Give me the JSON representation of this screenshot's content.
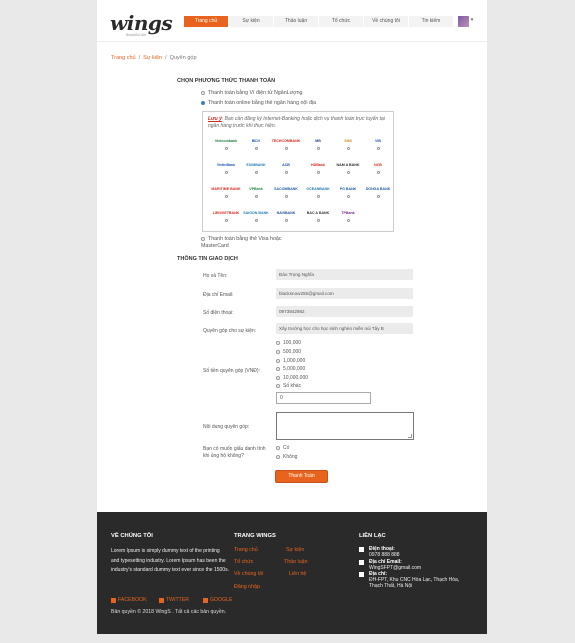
{
  "header": {
    "logo_text": "wings",
    "logo_subtext": "Beautiful Life",
    "nav": [
      "Trang chủ",
      "Sự kiện",
      "Thảo luận",
      "Tổ chức",
      "Về chúng tôi",
      "Tin kiếm"
    ],
    "active_nav_index": 0,
    "accent_color": "#e8641e"
  },
  "breadcrumb": {
    "items": [
      "Trang chủ",
      "Sự kiện",
      "Quyên góp"
    ],
    "separator": "/"
  },
  "payment": {
    "section_title": "CHỌN PHƯƠNG THỨC THANH TOÁN",
    "options": [
      "Thanh toán bằng Ví điện tử NgânLượng",
      "Thanh toán online bằng thẻ ngân hàng nội địa",
      "Thanh toán bằng thẻ Visa hoặc MasterCard"
    ],
    "selected_index": 1,
    "note_label": "Lưu ý",
    "note_text": ": Bạn cần đăng ký Internet-Banking hoặc dịch vụ thanh toán trực tuyến tại ngân hàng trước khi thực hiện.",
    "banks": [
      {
        "name": "Vietcombank",
        "color": "#1e7a3c"
      },
      {
        "name": "BIDV",
        "color": "#1d5aa8"
      },
      {
        "name": "TECHCOMBANK",
        "color": "#d9261c"
      },
      {
        "name": "MB",
        "color": "#1d3f8a"
      },
      {
        "name": "SHB",
        "color": "#d4881b"
      },
      {
        "name": "VIB",
        "color": "#1e5aa8"
      },
      {
        "name": "VietinBank",
        "color": "#1e5aa8"
      },
      {
        "name": "EXIMBANK",
        "color": "#1e7ab5"
      },
      {
        "name": "ACB",
        "color": "#1e4ea0"
      },
      {
        "name": "HDBank",
        "color": "#d9261c"
      },
      {
        "name": "NAM A BANK",
        "color": "#2b2b2b"
      },
      {
        "name": "NCB",
        "color": "#d9261c"
      },
      {
        "name": "MARITIME BANK",
        "color": "#d9261c"
      },
      {
        "name": "VPBank",
        "color": "#1e8a3c"
      },
      {
        "name": "SACOMBANK",
        "color": "#1e5aa8"
      },
      {
        "name": "OCEANBANK",
        "color": "#1e7ab5"
      },
      {
        "name": "PG BANK",
        "color": "#1e5aa8"
      },
      {
        "name": "DONGA BANK",
        "color": "#1e5aa8"
      },
      {
        "name": "LIENVIETBANK",
        "color": "#d9261c"
      },
      {
        "name": "SAIGON BANK",
        "color": "#1e7ab5"
      },
      {
        "name": "NAVIBANK",
        "color": "#1e4ea0"
      },
      {
        "name": "BAC A BANK",
        "color": "#333333"
      },
      {
        "name": "TPBank",
        "color": "#7a2a8a"
      }
    ]
  },
  "transaction": {
    "section_title": "THÔNG TIN GIAO DỊCH",
    "fields": [
      {
        "label": "Họ và Tên:",
        "value": "Đào Trọng Nghĩa"
      },
      {
        "label": "Địa chỉ Email:",
        "value": "blacksnow255@gmail.com"
      },
      {
        "label": "Số điện thoại:",
        "value": "0973842982"
      },
      {
        "label": "Quyên góp cho sự kiện:",
        "value": "Xây trường học cho học sinh nghèo miền núi Tây B"
      }
    ],
    "amount_label": "Số tiền quyên góp (VNĐ):",
    "amount_options": [
      "100,000",
      "500,000",
      "1,000,000",
      "5,000,000",
      "10,000,000",
      "Số khác"
    ],
    "amount_value": "0",
    "message_label": "Nội dung quyên góp:",
    "anonymous_label": "Bạn có muốn giấu danh tính khi ủng hộ không?",
    "anonymous_options": [
      "Có",
      "Không"
    ],
    "submit_label": "Thanh Toán"
  },
  "footer": {
    "about_title": "VỀ CHÚNG TÔI",
    "about_text": "Lorem Ipsum is simply dummy text of the printing and typesetting industry. Lorem Ipsum has been the industry's standard dummy text ever since the 1500s.",
    "links_title": "TRANG WINGS",
    "links": [
      "Trang chủ",
      "Sự kiện",
      "Tổ chức",
      "Thảo luận",
      "Về chúng tôi",
      "Liên hệ",
      "Đăng nhập"
    ],
    "contact_title": "LIÊN LẠC",
    "phone_label": "Điện thoại:",
    "phone": "0978 888 888",
    "email_label": "Địa chỉ Email:",
    "email": "WingSFPT@gmail.com",
    "address_label": "Địa chỉ:",
    "address": "ĐH-FPT, Khu CNC Hòa Lạc, Thạch Hòa, Thạch Thất, Hà Nội",
    "social": [
      "FACEBOOK",
      "TWITTER",
      "GOOGLE"
    ],
    "copyright": "Bản quyền © 2018 WingS . Tất cả các bản quyền."
  }
}
